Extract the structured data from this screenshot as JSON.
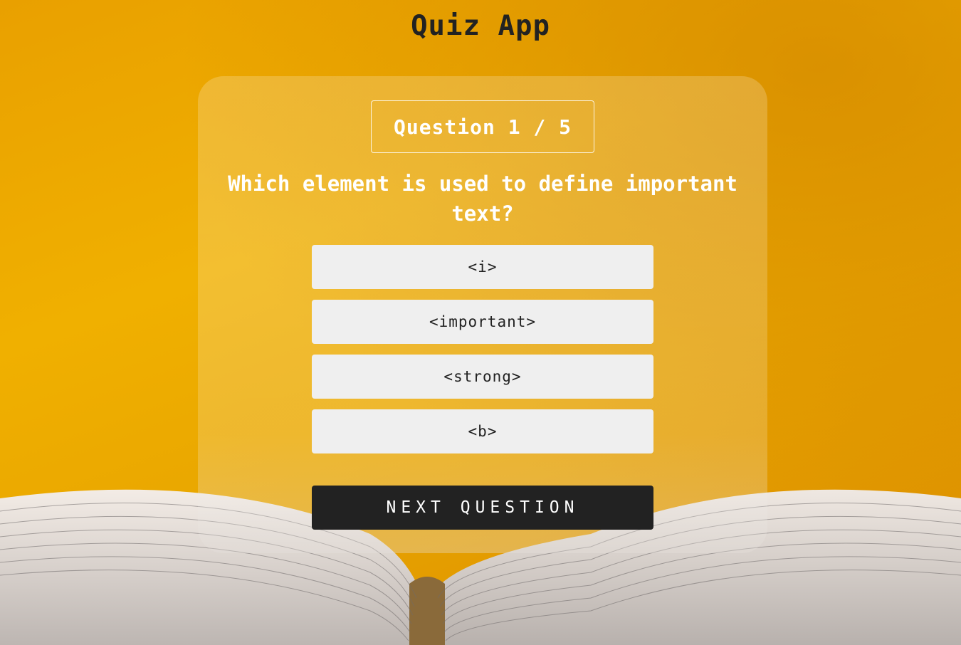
{
  "app": {
    "title": "Quiz App"
  },
  "quiz": {
    "counter": "Question 1 / 5",
    "question": "Which element is used to define important text?",
    "answers": [
      {
        "label": "<i>"
      },
      {
        "label": "<important>"
      },
      {
        "label": "<strong>"
      },
      {
        "label": "<b>"
      }
    ],
    "next_label": "NEXT QUESTION"
  },
  "colors": {
    "background_accent": "#f0b000",
    "answer_bg": "#efefef",
    "next_bg": "#222222",
    "title_text": "#222222"
  }
}
